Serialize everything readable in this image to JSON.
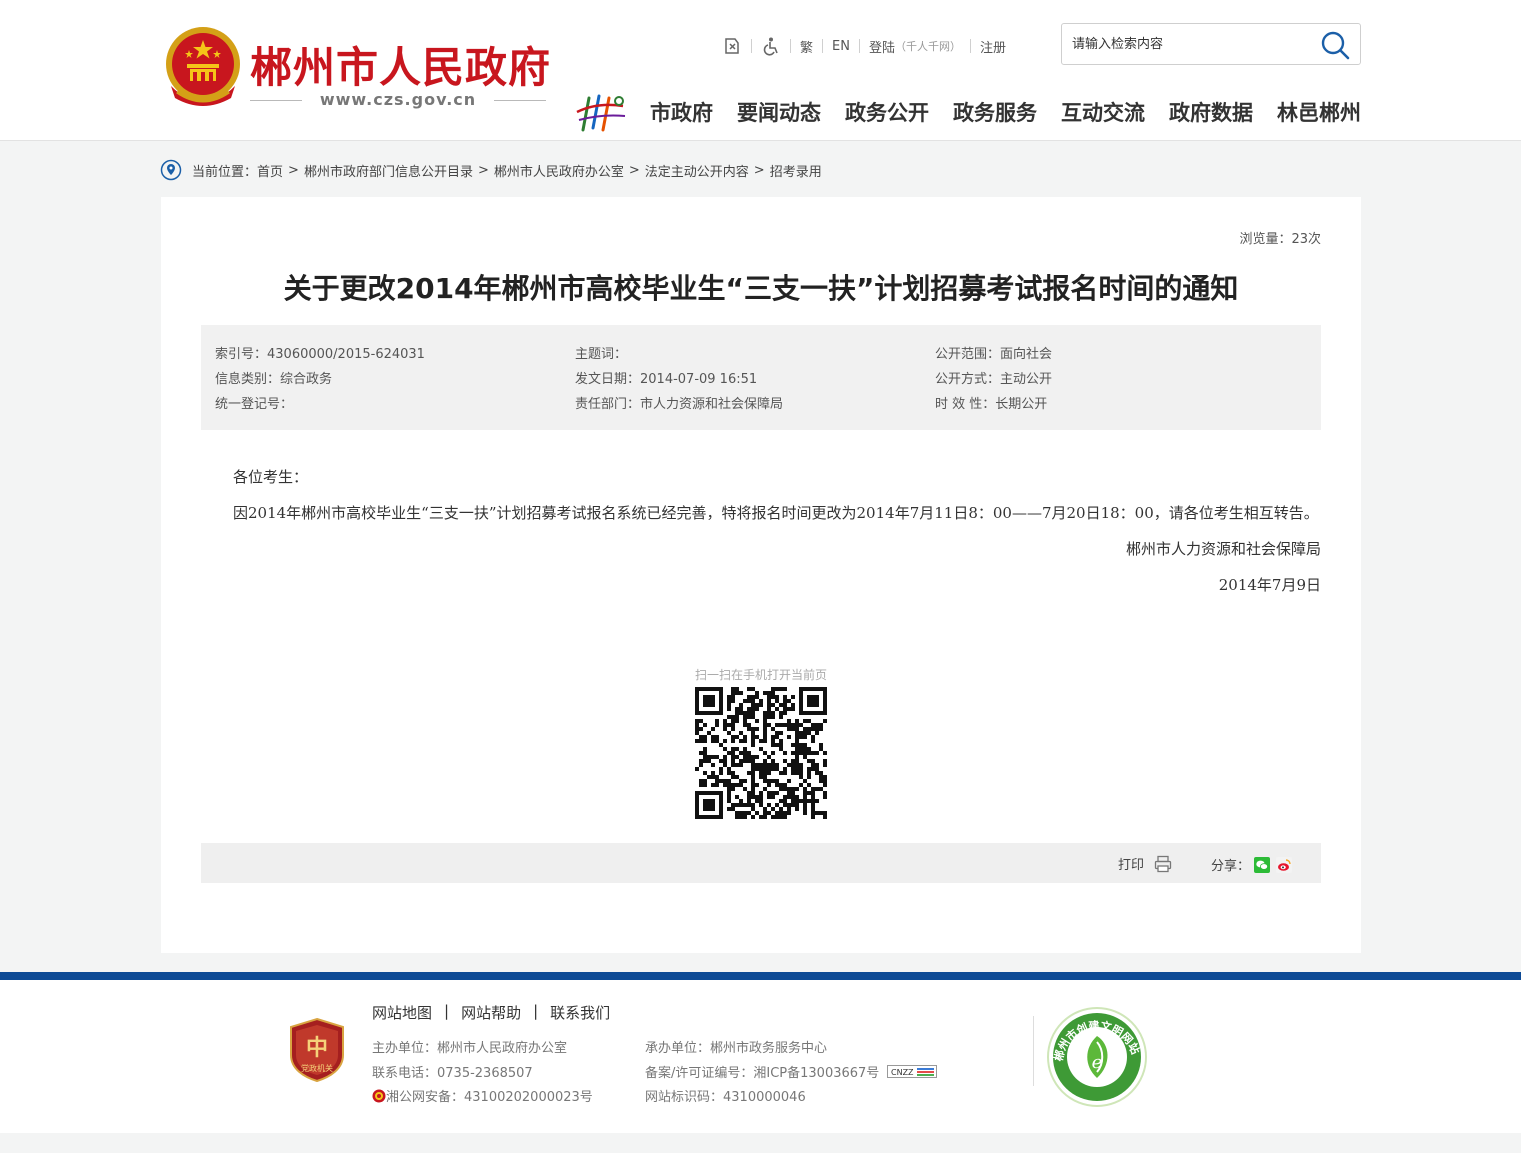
{
  "header": {
    "site_title": "郴州市人民政府",
    "site_domain": "www.czs.gov.cn",
    "toplinks": {
      "traditional": "繁",
      "english": "EN",
      "login": "登陆",
      "login_note": "（千人千网）",
      "register": "注册"
    },
    "search": {
      "placeholder": "请输入检索内容"
    },
    "nav": [
      "市政府",
      "要闻动态",
      "政务公开",
      "政务服务",
      "互动交流",
      "政府数据",
      "林邑郴州"
    ]
  },
  "breadcrumb": {
    "label": "当前位置：",
    "items": [
      "首页",
      "郴州市政府部门信息公开目录",
      "郴州市人民政府办公室",
      "法定主动公开内容",
      "招考录用"
    ],
    "separator": ">"
  },
  "article": {
    "views": "浏览量：23次",
    "title": "关于更改2014年郴州市高校毕业生“三支一扶”计划招募考试报名时间的通知",
    "meta": {
      "index_no": "索引号：43060000/2015-624031",
      "subject": "主题词：",
      "scope": "公开范围：面向社会",
      "category": "信息类别：综合政务",
      "issue_date": "发文日期：2014-07-09 16:51",
      "method": "公开方式：主动公开",
      "reg_no": "统一登记号：",
      "department": "责任部门：市人力资源和社会保障局",
      "validity": "时 效 性：长期公开"
    },
    "greeting": "各位考生：",
    "body": "因2014年郴州市高校毕业生“三支一扶”计划招募考试报名系统已经完善，特将报名时间更改为2014年7月11日8：00——7月20日18：00，请各位考生相互转告。",
    "signature": "郴州市人力资源和社会保障局",
    "date": "2014年7月9日",
    "qr_caption": "扫一扫在手机打开当前页",
    "print_label": "打印",
    "share_label": "分享："
  },
  "footer": {
    "links": [
      "网站地图",
      "网站帮助",
      "联系我们"
    ],
    "host": "主办单位：郴州市人民政府办公室",
    "phone": "联系电话：0735-2368507",
    "police": "湘公网安备：43100202000023号",
    "undertaker": "承办单位：郴州市政务服务中心",
    "icp": "备案/许可证编号：湘ICP备13003667号",
    "site_id": "网站标识码：4310000046",
    "party_badge": "党政机关",
    "civil_badge": "郴州市创建文明网站",
    "cnzz": "CNZZ"
  },
  "colors": {
    "brand_red": "#c8161e",
    "footer_blue": "#0d4a95",
    "accent_blue": "#1b5fa8"
  }
}
